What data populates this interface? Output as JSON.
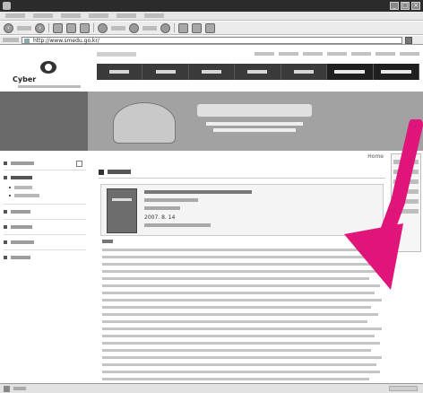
{
  "browser": {
    "window_title": "",
    "address": "http://www.smedu.go.kr/",
    "menu_items": [
      "",
      "",
      "",
      "",
      "",
      ""
    ]
  },
  "site": {
    "logo_name": "Cyber",
    "utility_links": [
      "",
      "",
      "",
      "",
      "",
      "",
      "",
      ""
    ],
    "gnb": [
      "",
      "",
      "",
      "",
      "",
      "",
      ""
    ],
    "gnb_highlight_index": 5
  },
  "visual": {
    "section_title": ""
  },
  "lnb": {
    "items": [
      {
        "label": "",
        "level": 1
      },
      {
        "label": "",
        "level": 1
      },
      {
        "label": "",
        "level": 2
      },
      {
        "label": "",
        "level": 2
      },
      {
        "label": "",
        "level": 1
      },
      {
        "label": "",
        "level": 1
      },
      {
        "label": "",
        "level": 1
      },
      {
        "label": "",
        "level": 1
      }
    ]
  },
  "content": {
    "location": "Home",
    "doc_title": "",
    "book": {
      "title": "",
      "date": "2007. 8. 14"
    }
  },
  "colors": {
    "annotation_arrow": "#e0157a",
    "gnb_bg": "#3a3a3a"
  }
}
